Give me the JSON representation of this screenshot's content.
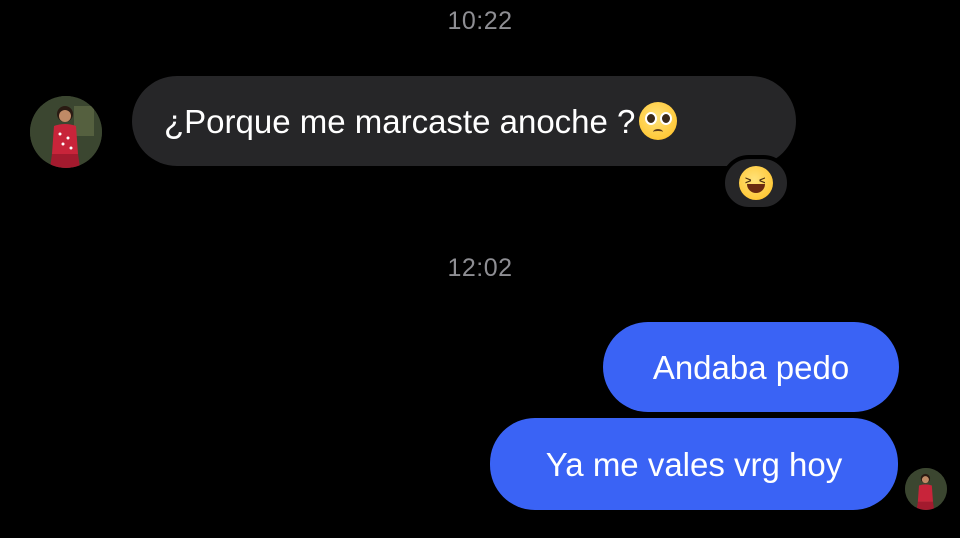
{
  "thread": {
    "timestamp_1": "10:22",
    "timestamp_2": "12:02"
  },
  "messages": [
    {
      "direction": "incoming",
      "text": "¿Porque me marcaste anoche ?",
      "trailing_emoji": "pleading-face-icon",
      "reaction": "laughing-face-icon"
    },
    {
      "direction": "outgoing",
      "text": "Andaba pedo"
    },
    {
      "direction": "outgoing",
      "text": "Ya me vales vrg hoy"
    }
  ],
  "colors": {
    "background": "#000000",
    "incoming_bubble": "#262628",
    "outgoing_bubble": "#3a63f5",
    "timestamp": "#8e8e93"
  }
}
